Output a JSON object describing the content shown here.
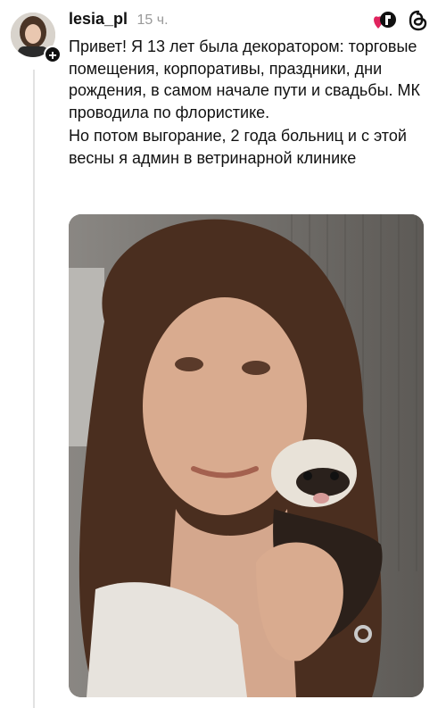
{
  "post": {
    "username": "lesia_pl",
    "time": "15 ч.",
    "paragraphs": [
      "Привет! Я 13 лет была декоратором: торговые помещения, корпоративы, праздники, дни рождения, в самом начале пути и свадьбы. МК проводила по флористике.",
      "Но потом выгорание, 2 года больниц и с этой весны  я админ в ветринарной клинике"
    ]
  },
  "icons": {
    "follow": "plus-icon",
    "badge": "heart-badge-icon",
    "threads": "threads-logo-icon"
  },
  "colors": {
    "text": "#111111",
    "muted": "#999999",
    "heart": "#e0245e"
  }
}
